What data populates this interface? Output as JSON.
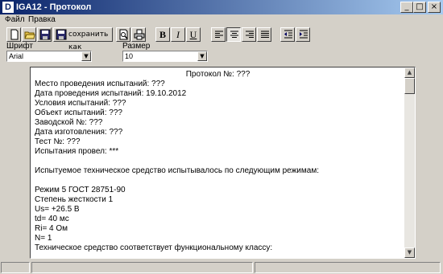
{
  "window": {
    "app_icon": "D",
    "title": "IGA12 - Протокол",
    "minimize": "_",
    "maximize": "□",
    "close": "×"
  },
  "menu": {
    "file": "Файл",
    "edit": "Правка"
  },
  "toolbar": {
    "save_as_label": "сохранить как",
    "bold": "B",
    "italic": "I",
    "underline": "U"
  },
  "font": {
    "font_label": "Шрифт",
    "font_value": "Arial",
    "size_label": "Размер",
    "size_value": "10"
  },
  "document": {
    "lines": [
      "Протокол №: ???",
      "Место проведения испытаний: ???",
      "Дата проведения испытаний: 19.10.2012",
      "Условия испытаний: ???",
      "Объект испытаний: ???",
      "Заводской №: ???",
      "Дата изготовления: ???",
      "Тест №: ???",
      "Испытания провел: ***",
      "",
      "Испытуемое техническое средство испытывалось по следующим режимам:",
      "",
      "Режим 5 ГОСТ 28751-90",
      "Степень жесткости 1",
      "Us= +26.5 В",
      "td= 40 мс",
      "Ri= 4 Ом",
      "N= 1",
      "Техническое средство соответствует функциональному классу:"
    ]
  },
  "scroll": {
    "up": "▲",
    "down": "▼"
  },
  "combo_arrow": "▼"
}
